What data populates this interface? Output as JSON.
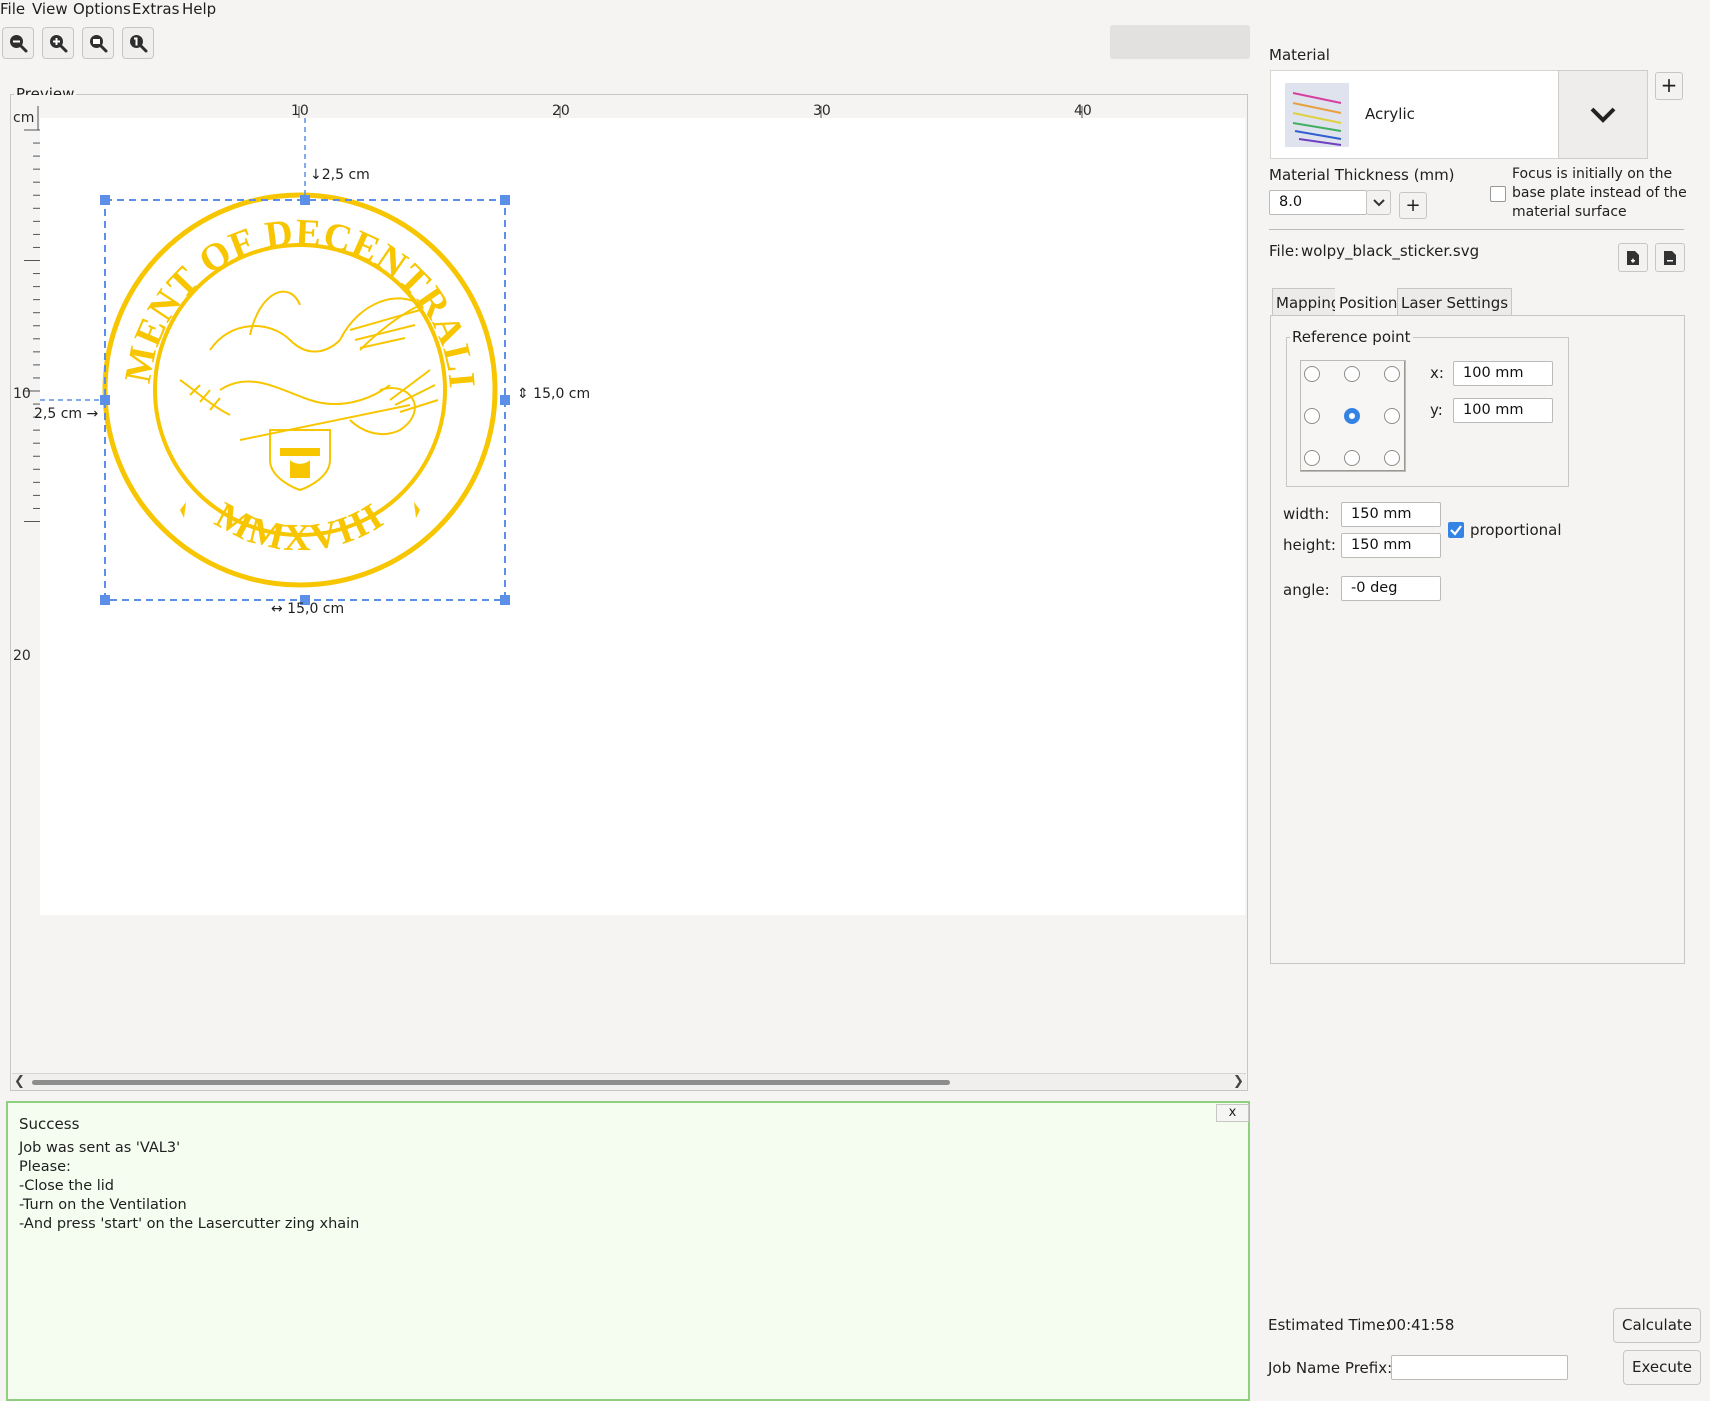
{
  "menu": [
    "File",
    "View",
    "Options",
    "Extras",
    "Help"
  ],
  "toolbar": {
    "icons": [
      "zoom-out-icon",
      "zoom-in-icon",
      "zoom-fit-icon",
      "zoom-reset-icon"
    ]
  },
  "preview": {
    "title": "Preview",
    "ruler_unit": "cm",
    "h_ticks": [
      "10",
      "20",
      "30",
      "40"
    ],
    "v_ticks": [
      "10",
      "20"
    ],
    "dim_top": "↓2,5 cm",
    "dim_left": "2,5 cm →",
    "dim_height": "⇕ 15,0 cm",
    "dim_width": "↔ 15,0 cm",
    "seal_text_top": "DEPARTMENT OF DECENTRALIZATION",
    "seal_text_bottom": "MMXVIII"
  },
  "message": {
    "title": "Success",
    "close": "x",
    "lines": [
      "Job was sent as 'VAL3'",
      "Please:",
      "-Close the lid",
      "-Turn on the Ventilation",
      "-And press 'start' on the Lasercutter zing xhain"
    ]
  },
  "material": {
    "label": "Material",
    "name": "Acrylic",
    "add": "+"
  },
  "thickness": {
    "label": "Material Thickness (mm)",
    "value": "8.0",
    "add": "+"
  },
  "focus": {
    "line1": "Focus is initially on the",
    "line2": "base plate instead of the",
    "line3": "material surface",
    "checked": false
  },
  "file": {
    "label": "File:",
    "name": "wolpy_black_sticker.svg"
  },
  "tabs": [
    "Mapping",
    "Position",
    "Laser Settings"
  ],
  "position": {
    "refpoint_title": "Reference point",
    "x_label": "x:",
    "x_value": "100 mm",
    "y_label": "y:",
    "y_value": "100 mm",
    "width_label": "width:",
    "width_value": "150 mm",
    "height_label": "height:",
    "height_value": "150 mm",
    "proportional_label": "proportional",
    "proportional": true,
    "angle_label": "angle:",
    "angle_value": "-0 deg"
  },
  "bottom": {
    "est_label": "Estimated Time:",
    "est_value": "00:41:58",
    "calculate": "Calculate",
    "prefix_label": "Job Name Prefix:",
    "prefix_value": "",
    "execute": "Execute"
  },
  "colors": {
    "seal": "#f7c600",
    "selection": "#5b8fe8",
    "accent": "#3584e4",
    "success_border": "#8fcf7f"
  }
}
